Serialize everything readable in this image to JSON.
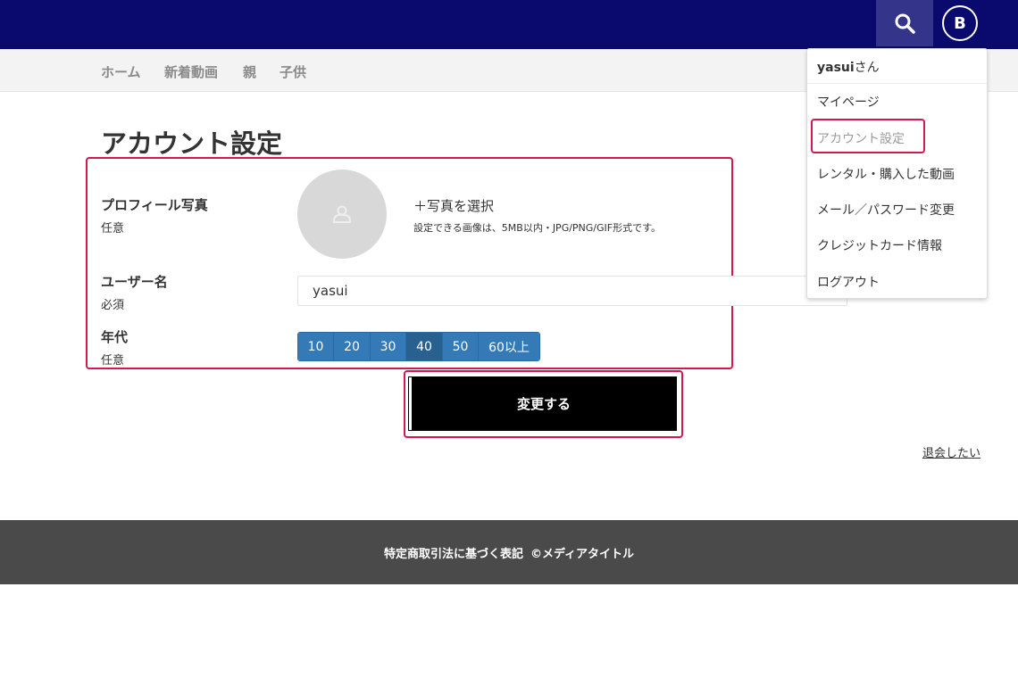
{
  "header": {
    "search_icon": "search-icon",
    "avatar_letter": "B",
    "bg_color": "#0a0a6e"
  },
  "nav": {
    "items": [
      {
        "label": "ホーム"
      },
      {
        "label": "新着動画"
      },
      {
        "label": "親"
      },
      {
        "label": "子供"
      }
    ]
  },
  "page": {
    "title": "アカウント設定"
  },
  "form": {
    "profile_photo": {
      "label": "プロフィール写真",
      "requirement": "任意",
      "select_label": "＋写真を選択",
      "note": "設定できる画像は、5MB以内・JPG/PNG/GIF形式です。",
      "placeholder_icon": "user-icon"
    },
    "username": {
      "label": "ユーザー名",
      "requirement": "必須",
      "value": "yasui"
    },
    "age": {
      "label": "年代",
      "requirement": "任意",
      "options": [
        "10",
        "20",
        "30",
        "40",
        "50",
        "60以上"
      ],
      "selected": "40"
    },
    "submit_label": "変更する"
  },
  "withdraw_label": "退会したい",
  "footer": {
    "legal": "特定商取引法に基づく表記",
    "copyright": "©メディアタイトル"
  },
  "dropdown": {
    "user_name": "yasui",
    "user_suffix": "さん",
    "items": [
      {
        "label": "マイページ"
      },
      {
        "label": "アカウント設定"
      },
      {
        "label": "レンタル・購入した動画"
      },
      {
        "label": "メール／パスワード変更"
      },
      {
        "label": "クレジットカード情報"
      },
      {
        "label": "ログアウト"
      }
    ]
  },
  "colors": {
    "highlight": "#d6174f",
    "button_blue": "#337ab7",
    "button_blue_active": "#286090",
    "footer": "#4a4a4a"
  }
}
